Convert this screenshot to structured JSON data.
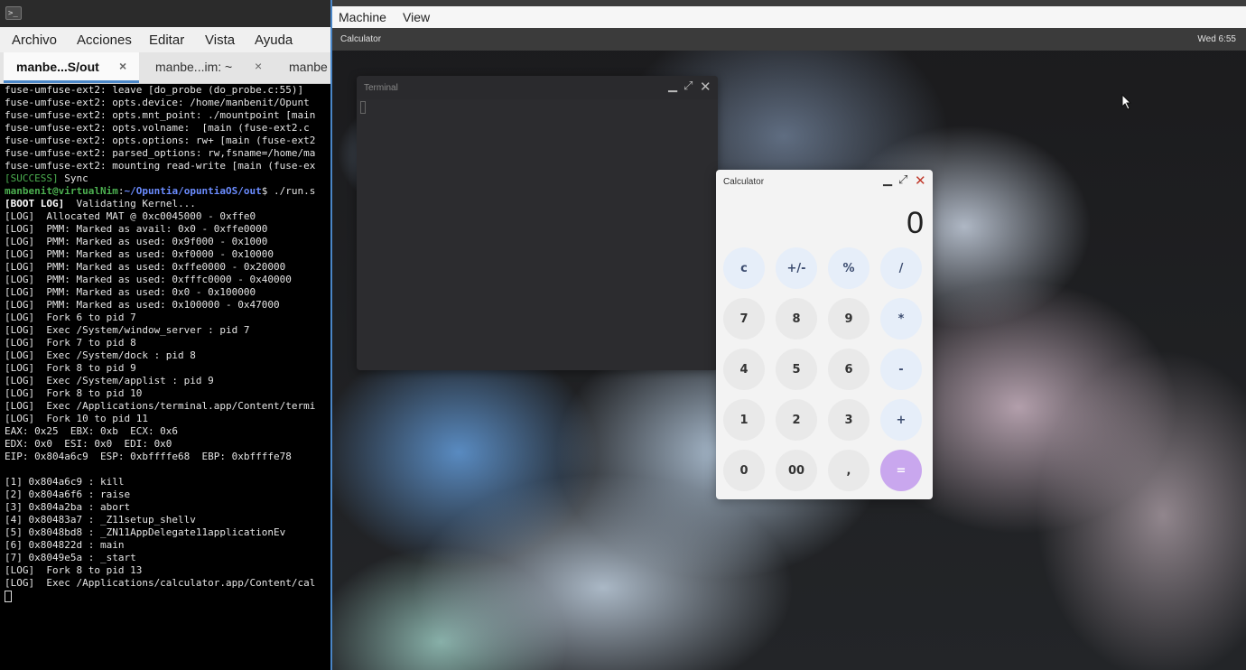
{
  "host_terminal": {
    "menu": [
      "Archivo",
      "Acciones",
      "Editar",
      "Vista",
      "Ayuda"
    ],
    "tabs": [
      {
        "label": "manbe...S/out",
        "close": "×"
      },
      {
        "label": "manbe...im: ~",
        "close": "×"
      },
      {
        "label": "manbe"
      }
    ],
    "lines_before": [
      "fuse-umfuse-ext2: leave [do_probe (do_probe.c:55)]",
      "fuse-umfuse-ext2: opts.device: /home/manbenit/Opunt",
      "fuse-umfuse-ext2: opts.mnt_point: ./mountpoint [main",
      "fuse-umfuse-ext2: opts.volname:  [main (fuse-ext2.c",
      "fuse-umfuse-ext2: opts.options: rw+ [main (fuse-ext2",
      "fuse-umfuse-ext2: parsed_options: rw,fsname=/home/ma",
      "fuse-umfuse-ext2: mounting read-write [main (fuse-ex"
    ],
    "success_tag": "[SUCCESS]",
    "success_text": " Sync",
    "prompt_user": "manbenit@virtualNim",
    "prompt_colon": ":",
    "prompt_path": "~/Opuntia/opuntiaOS/out",
    "prompt_cmd": "$ ./run.s",
    "boot_tag": "[BOOT LOG]",
    "boot_text": "  Validating Kernel...",
    "lines_after": [
      "[LOG]  Allocated MAT @ 0xc0045000 - 0xffe0",
      "[LOG]  PMM: Marked as avail: 0x0 - 0xffe0000",
      "[LOG]  PMM: Marked as used: 0x9f000 - 0x1000",
      "[LOG]  PMM: Marked as used: 0xf0000 - 0x10000",
      "[LOG]  PMM: Marked as used: 0xffe0000 - 0x20000",
      "[LOG]  PMM: Marked as used: 0xfffc0000 - 0x40000",
      "[LOG]  PMM: Marked as used: 0x0 - 0x100000",
      "[LOG]  PMM: Marked as used: 0x100000 - 0x47000",
      "[LOG]  Fork 6 to pid 7",
      "[LOG]  Exec /System/window_server : pid 7",
      "[LOG]  Fork 7 to pid 8",
      "[LOG]  Exec /System/dock : pid 8",
      "[LOG]  Fork 8 to pid 9",
      "[LOG]  Exec /System/applist : pid 9",
      "[LOG]  Fork 8 to pid 10",
      "[LOG]  Exec /Applications/terminal.app/Content/termi",
      "[LOG]  Fork 10 to pid 11",
      "EAX: 0x25  EBX: 0xb  ECX: 0x6",
      "EDX: 0x0  ESI: 0x0  EDI: 0x0",
      "EIP: 0x804a6c9  ESP: 0xbffffe68  EBP: 0xbffffe78",
      "",
      "[1] 0x804a6c9 : kill",
      "[2] 0x804a6f6 : raise",
      "[3] 0x804a2ba : abort",
      "[4] 0x80483a7 : _Z11setup_shellv",
      "[5] 0x8048bd8 : _ZN11AppDelegate11applicationEv",
      "[6] 0x804822d : main",
      "[7] 0x8049e5a : _start",
      "[LOG]  Fork 8 to pid 13",
      "[LOG]  Exec /Applications/calculator.app/Content/cal"
    ]
  },
  "vm": {
    "menu": [
      "Machine",
      "View"
    ],
    "guest_bar": {
      "app_name": "Calculator",
      "clock": "Wed  6:55"
    },
    "terminal_window": {
      "title": "Terminal"
    },
    "calculator": {
      "title": "Calculator",
      "display": "0",
      "rows": [
        [
          "c",
          "+/-",
          "%",
          "/"
        ],
        [
          "7",
          "8",
          "9",
          "*"
        ],
        [
          "4",
          "5",
          "6",
          "-"
        ],
        [
          "1",
          "2",
          "3",
          "+"
        ],
        [
          "0",
          "00",
          ",",
          "="
        ]
      ]
    }
  },
  "colors": {
    "accent_blue": "#4a86c7",
    "equals_button": "#c9a7ee",
    "operator_button": "#e6eef9",
    "digit_button": "#e9e9e9",
    "prompt_green": "#4caf50",
    "prompt_path_blue": "#6b8cff"
  },
  "icons": [
    "terminal-app-icon",
    "tab-close-icon",
    "minimize-icon",
    "maximize-icon",
    "close-icon",
    "mouse-pointer-icon"
  ]
}
